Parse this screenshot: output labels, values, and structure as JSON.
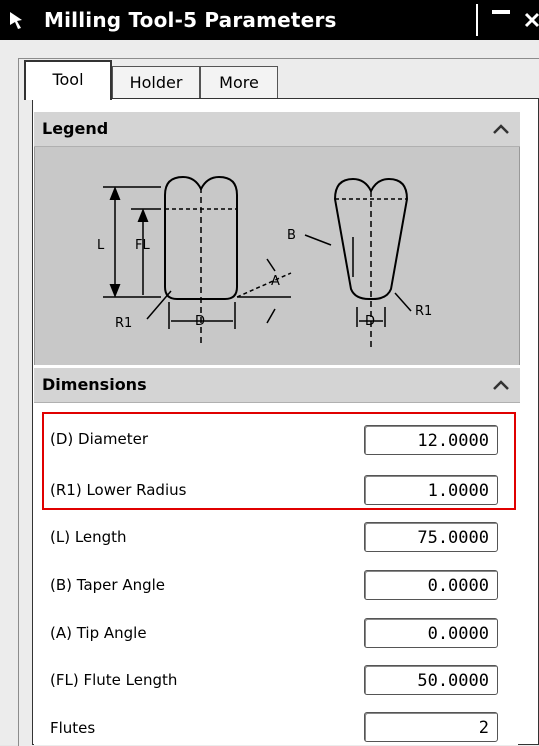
{
  "window": {
    "title": "Milling Tool-5 Parameters"
  },
  "tabs": [
    {
      "label": "Tool",
      "active": true
    },
    {
      "label": "Holder",
      "active": false
    },
    {
      "label": "More",
      "active": false
    }
  ],
  "legend": {
    "header": "Legend",
    "labels": {
      "L": "L",
      "FL": "FL",
      "R1": "R1",
      "D": "D",
      "A": "A",
      "B": "B"
    }
  },
  "dimensions": {
    "header": "Dimensions",
    "rows": [
      {
        "label": "(D) Diameter",
        "value": "12.0000"
      },
      {
        "label": "(R1) Lower Radius",
        "value": "1.0000"
      },
      {
        "label": "(L) Length",
        "value": "75.0000"
      },
      {
        "label": "(B) Taper Angle",
        "value": "0.0000"
      },
      {
        "label": "(A) Tip Angle",
        "value": "0.0000"
      },
      {
        "label": "(FL) Flute Length",
        "value": "50.0000"
      },
      {
        "label": "Flutes",
        "value": "2"
      }
    ]
  },
  "colors": {
    "highlight": "#e00000",
    "titlebar": "#000000",
    "legend_bg": "#c8c8c8",
    "header_bg": "#d4d4d4"
  }
}
